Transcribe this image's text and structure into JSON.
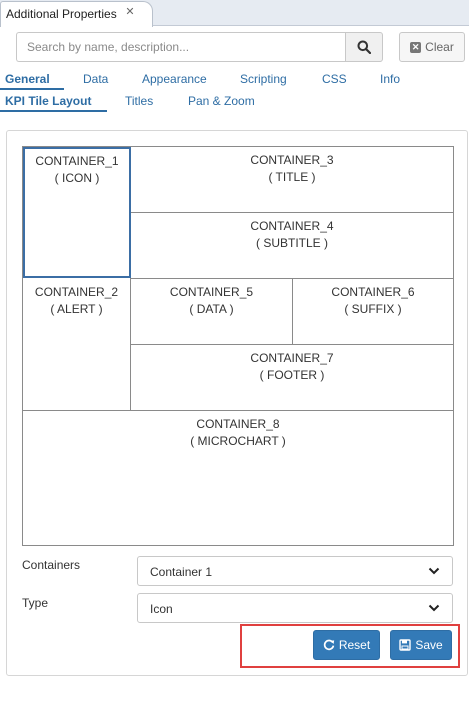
{
  "view_tab": {
    "title": "Additional Properties",
    "close_glyph": "✕"
  },
  "search": {
    "placeholder": "Search by name, description...",
    "clear_label": "Clear"
  },
  "tabs_row1": [
    {
      "label": "General",
      "active": true
    },
    {
      "label": "Data",
      "active": false
    },
    {
      "label": "Appearance",
      "active": false
    },
    {
      "label": "Scripting",
      "active": false
    },
    {
      "label": "CSS",
      "active": false
    },
    {
      "label": "Info",
      "active": false
    }
  ],
  "tabs_row2": [
    {
      "label": "KPI Tile Layout",
      "active": true
    },
    {
      "label": "Titles",
      "active": false
    },
    {
      "label": "Pan & Zoom",
      "active": false
    }
  ],
  "layout": {
    "containers": [
      {
        "name": "CONTAINER_1",
        "role": "( ICON )",
        "selected": true
      },
      {
        "name": "CONTAINER_2",
        "role": "( ALERT )",
        "selected": false
      },
      {
        "name": "CONTAINER_3",
        "role": "( TITLE )",
        "selected": false
      },
      {
        "name": "CONTAINER_4",
        "role": "( SUBTITLE )",
        "selected": false
      },
      {
        "name": "CONTAINER_5",
        "role": "( DATA )",
        "selected": false
      },
      {
        "name": "CONTAINER_6",
        "role": "( SUFFIX )",
        "selected": false
      },
      {
        "name": "CONTAINER_7",
        "role": "( FOOTER )",
        "selected": false
      },
      {
        "name": "CONTAINER_8",
        "role": "( MICROCHART )",
        "selected": false
      }
    ]
  },
  "form": {
    "containers_label": "Containers",
    "containers_value": "Container 1",
    "type_label": "Type",
    "type_value": "Icon"
  },
  "actions": {
    "reset_label": "Reset",
    "save_label": "Save"
  },
  "colors": {
    "accent": "#337ab7",
    "tab_text": "#2e6da4",
    "highlight": "#e0403f",
    "selected_border": "#3b6ea5"
  },
  "icons": [
    "close-icon",
    "search-icon",
    "clear-x-icon",
    "chevron-down-icon",
    "refresh-icon",
    "save-disk-icon"
  ]
}
